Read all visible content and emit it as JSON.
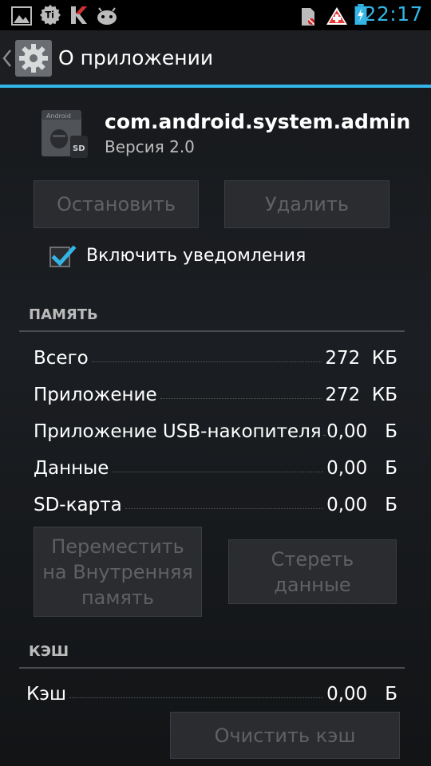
{
  "status_bar": {
    "time": "22:17",
    "icons": [
      "gallery-icon",
      "titanium-backup-icon",
      "kaspersky-icon",
      "android-robot-icon",
      "sim-card-icon",
      "swiss-flag-icon",
      "battery-charging-icon"
    ]
  },
  "action_bar": {
    "title": "О приложении",
    "icon": "settings-gear-icon"
  },
  "app": {
    "name": "com.android.system.admin",
    "version": "Версия 2.0",
    "icon_badge": "SD",
    "icon_text": "Android"
  },
  "buttons": {
    "stop": "Остановить",
    "uninstall": "Удалить",
    "move": "Переместить\nна Внутренняя\nпамять",
    "clear_data": "Стереть\nданные",
    "clear_cache": "Очистить кэш"
  },
  "notifications": {
    "label": "Включить уведомления",
    "checked": true
  },
  "storage": {
    "header": "ПАМЯТЬ",
    "rows": [
      {
        "label": "Всего",
        "value": "272  КБ"
      },
      {
        "label": "Приложение",
        "value": "272  КБ"
      },
      {
        "label": "Приложение USB-накопителя",
        "value": "0,00   Б"
      },
      {
        "label": "Данные",
        "value": "0,00   Б"
      },
      {
        "label": "SD-карта",
        "value": "0,00   Б"
      }
    ]
  },
  "cache": {
    "header": "КЭШ",
    "rows": [
      {
        "label": "Кэш",
        "value": "0,00   Б"
      }
    ]
  },
  "colors": {
    "accent": "#33b5e5",
    "background": "#1b1e22",
    "disabled_text": "#5f6165"
  }
}
